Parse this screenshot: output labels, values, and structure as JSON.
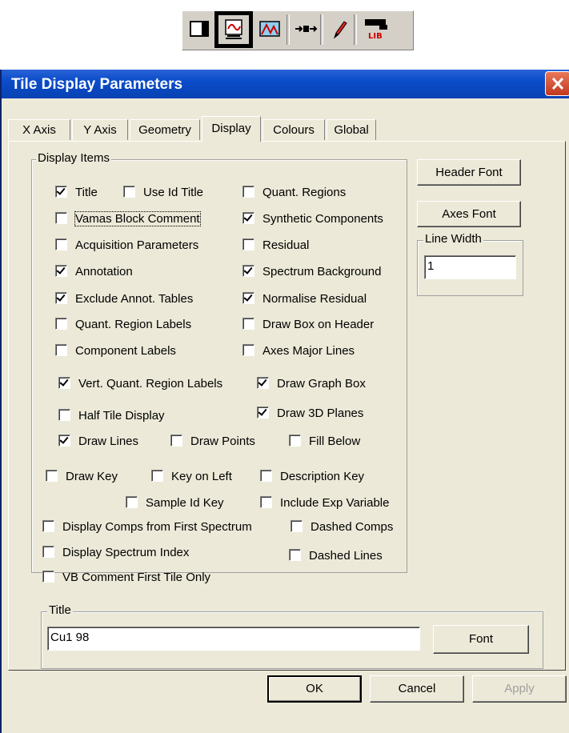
{
  "window_title": "Tile Display Parameters",
  "tabs": [
    "X Axis",
    "Y Axis",
    "Geometry",
    "Display",
    "Colours",
    "Global"
  ],
  "active_tab": "Display",
  "display_items": {
    "legend": "Display Items",
    "items": [
      {
        "label": "Title",
        "checked": true
      },
      {
        "label": "Use Id Title",
        "checked": false
      },
      {
        "label": "Quant. Regions",
        "checked": false
      },
      {
        "label": "Vamas Block Comment",
        "checked": false
      },
      {
        "label": "Synthetic Components",
        "checked": true
      },
      {
        "label": "Acquisition Parameters",
        "checked": false
      },
      {
        "label": "Residual",
        "checked": false
      },
      {
        "label": "Annotation",
        "checked": true
      },
      {
        "label": "Spectrum Background",
        "checked": true
      },
      {
        "label": "Exclude Annot. Tables",
        "checked": true
      },
      {
        "label": "Normalise Residual",
        "checked": true
      },
      {
        "label": "Quant. Region Labels",
        "checked": false
      },
      {
        "label": "Draw Box on Header",
        "checked": false
      },
      {
        "label": "Component Labels",
        "checked": false
      },
      {
        "label": "Axes Major Lines",
        "checked": false
      },
      {
        "label": "Vert. Quant. Region Labels",
        "checked": true
      },
      {
        "label": "Draw Graph Box",
        "checked": true
      },
      {
        "label": "Half Tile Display",
        "checked": false
      },
      {
        "label": "Draw 3D Planes",
        "checked": true
      },
      {
        "label": "Draw Lines",
        "checked": true
      },
      {
        "label": "Draw Points",
        "checked": false
      },
      {
        "label": "Fill Below",
        "checked": false
      }
    ]
  },
  "key_options": [
    {
      "label": "Draw Key",
      "checked": false
    },
    {
      "label": "Key on Left",
      "checked": false
    },
    {
      "label": "Description Key",
      "checked": false
    },
    {
      "label": "Sample Id Key",
      "checked": false
    },
    {
      "label": "Include Exp Variable",
      "checked": false
    },
    {
      "label": "Display Comps from First Spectrum",
      "checked": false
    },
    {
      "label": "Dashed Comps",
      "checked": false
    },
    {
      "label": "Display Spectrum Index",
      "checked": false
    },
    {
      "label": "Dashed Lines",
      "checked": false
    },
    {
      "label": "VB Comment First Tile Only",
      "checked": false
    }
  ],
  "right_panel": {
    "header_font_label": "Header Font",
    "axes_font_label": "Axes Font",
    "line_width_legend": "Line Width",
    "line_width_value": "1"
  },
  "title_group": {
    "legend": "Title",
    "value": "Cu1 98",
    "font_label": "Font"
  },
  "footer": {
    "ok_label": "OK",
    "cancel_label": "Cancel",
    "apply_label": "Apply"
  },
  "toolbar": {
    "icons": [
      "tile-icon",
      "display-parameters-icon",
      "spectrum-icon",
      "step-icon",
      "pencil-icon",
      "library-icon"
    ],
    "selected": "display-parameters-icon"
  },
  "colors": {
    "title_bar": "#0a4cc9",
    "dialog_bg": "#ece9d8",
    "close_button": "#c2371d"
  }
}
